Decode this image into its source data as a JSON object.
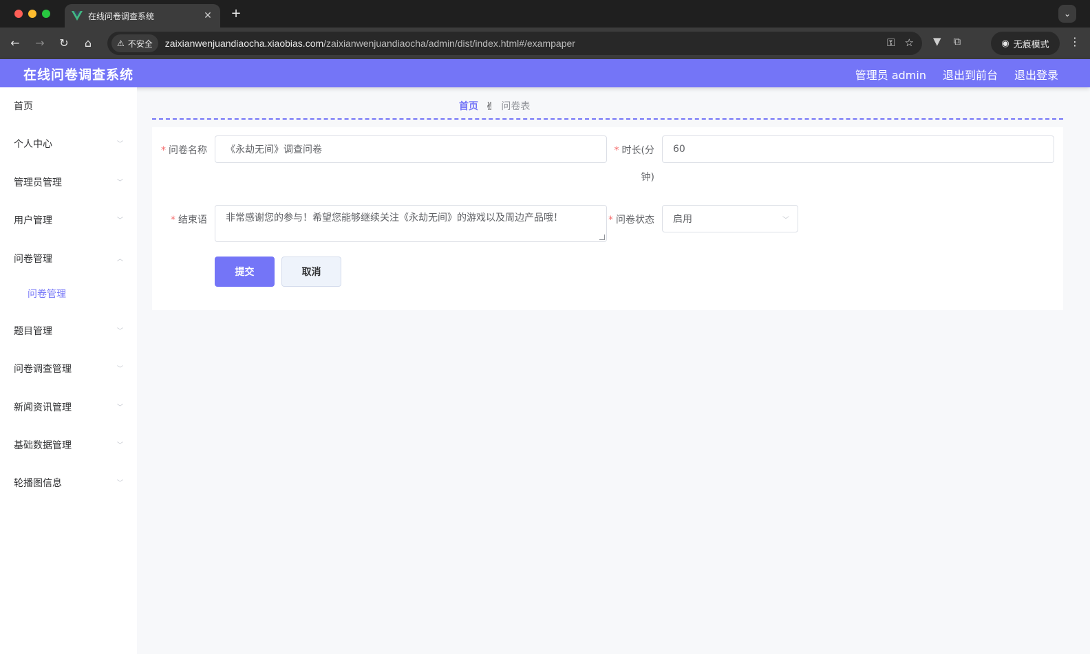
{
  "browser": {
    "tab_title": "在线问卷调查系统",
    "security_label": "不安全",
    "url_host": "zaixianwenjuandiaocha.xiaobias.com",
    "url_path": "/zaixianwenjuandiaocha/admin/dist/index.html#/exampaper",
    "incognito_label": "无痕模式"
  },
  "header": {
    "title": "在线问卷调查系统",
    "user": "管理员 admin",
    "to_front": "退出到前台",
    "logout": "退出登录"
  },
  "sidebar": {
    "items": [
      {
        "label": "首页"
      },
      {
        "label": "个人中心"
      },
      {
        "label": "管理员管理"
      },
      {
        "label": "用户管理"
      },
      {
        "label": "问卷管理"
      },
      {
        "label": "题目管理"
      },
      {
        "label": "问卷调查管理"
      },
      {
        "label": "新闻资讯管理"
      },
      {
        "label": "基础数据管理"
      },
      {
        "label": "轮播图信息"
      }
    ],
    "active_sub": "问卷管理"
  },
  "breadcrumb": {
    "home": "首页",
    "separator": "✌",
    "current": "问卷表"
  },
  "form": {
    "name_label": "问卷名称",
    "name_value": "《永劫无间》调查问卷",
    "duration_label_1": "时长(分",
    "duration_label_2": "钟)",
    "duration_value": "60",
    "ending_label": "结束语",
    "ending_value": "非常感谢您的参与！希望您能够继续关注《永劫无间》的游戏以及周边产品哦！",
    "status_label": "问卷状态",
    "status_value": "启用",
    "submit": "提交",
    "cancel": "取消"
  },
  "colors": {
    "accent": "#7475f7",
    "required": "#f56c6c"
  }
}
